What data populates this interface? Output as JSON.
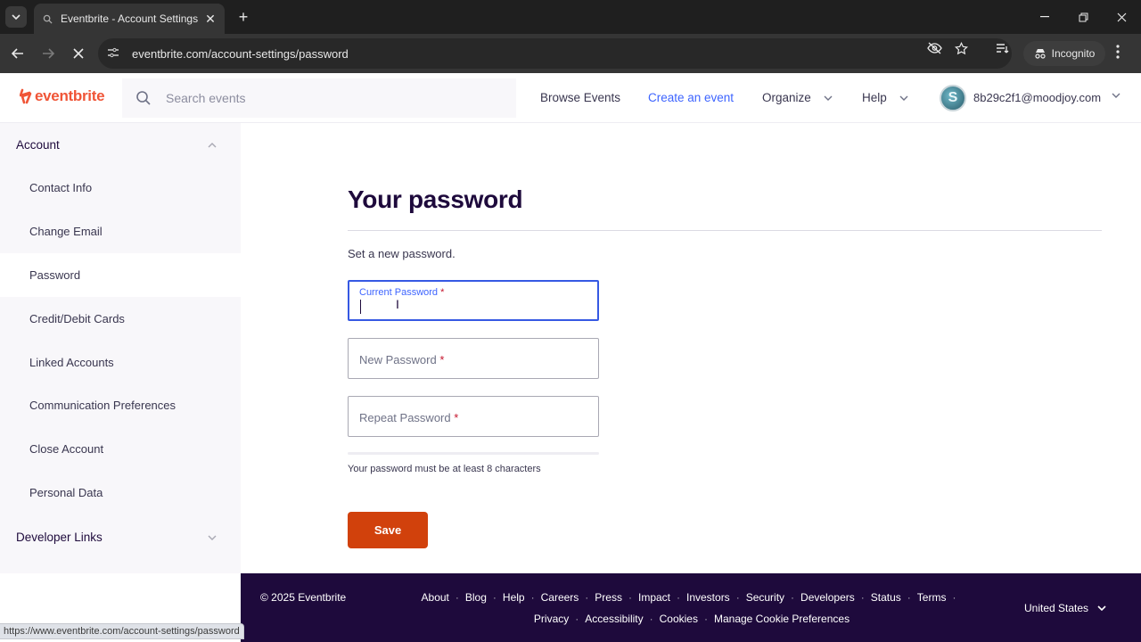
{
  "browser": {
    "tab_title": "Eventbrite - Account Settings",
    "new_tab": "+",
    "url_host": "eventbrite.com",
    "url_path": "/account-settings/password",
    "incognito_label": "Incognito",
    "status_url": "https://www.eventbrite.com/account-settings/password"
  },
  "header": {
    "logo_text": "eventbrite",
    "search_placeholder": "Search events",
    "nav": {
      "browse": "Browse Events",
      "create": "Create an event",
      "organize": "Organize",
      "help": "Help"
    },
    "avatar_letter": "S",
    "user_email": "8b29c2f1@moodjoy.com"
  },
  "sidebar": {
    "account_section": "Account",
    "items": [
      {
        "label": "Contact Info",
        "active": false
      },
      {
        "label": "Change Email",
        "active": false
      },
      {
        "label": "Password",
        "active": true
      },
      {
        "label": "Credit/Debit Cards",
        "active": false
      },
      {
        "label": "Linked Accounts",
        "active": false
      },
      {
        "label": "Communication Preferences",
        "active": false
      },
      {
        "label": "Close Account",
        "active": false
      },
      {
        "label": "Personal Data",
        "active": false
      }
    ],
    "developer_section": "Developer Links"
  },
  "main": {
    "title": "Your password",
    "subtitle": "Set a new password.",
    "fields": {
      "current": {
        "label": "Current Password",
        "value": ""
      },
      "new": {
        "label": "New Password",
        "value": ""
      },
      "repeat": {
        "label": "Repeat Password",
        "value": ""
      },
      "required_mark": "*"
    },
    "hint": "Your password must be at least 8 characters",
    "save_label": "Save"
  },
  "footer": {
    "copyright": "© 2025 Eventbrite",
    "links": [
      "About",
      "Blog",
      "Help",
      "Careers",
      "Press",
      "Impact",
      "Investors",
      "Security",
      "Developers",
      "Status",
      "Terms",
      "Privacy",
      "Accessibility",
      "Cookies",
      "Manage Cookie Preferences"
    ],
    "separator": "·",
    "country": "United States"
  },
  "colors": {
    "brand": "#f05537",
    "primary_button": "#d1410c",
    "link": "#3d64ff",
    "focus": "#3659e3",
    "footer_bg": "#1e0a3c"
  }
}
